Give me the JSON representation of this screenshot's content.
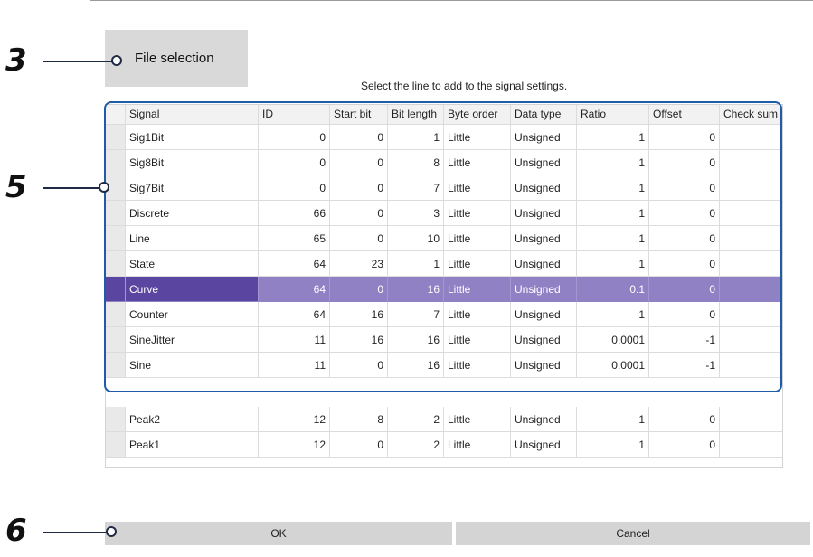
{
  "file_button": "File selection",
  "hint": "Select the line to add to the signal settings.",
  "columns": [
    "Signal",
    "ID",
    "Start bit",
    "Bit length",
    "Byte order",
    "Data type",
    "Ratio",
    "Offset",
    "Check sum"
  ],
  "rows": [
    {
      "signal": "Sig1Bit",
      "id": "0",
      "start": "0",
      "len": "1",
      "order": "Little",
      "dtype": "Unsigned",
      "ratio": "1",
      "offset": "0"
    },
    {
      "signal": "Sig8Bit",
      "id": "0",
      "start": "0",
      "len": "8",
      "order": "Little",
      "dtype": "Unsigned",
      "ratio": "1",
      "offset": "0"
    },
    {
      "signal": "Sig7Bit",
      "id": "0",
      "start": "0",
      "len": "7",
      "order": "Little",
      "dtype": "Unsigned",
      "ratio": "1",
      "offset": "0"
    },
    {
      "signal": "Discrete",
      "id": "66",
      "start": "0",
      "len": "3",
      "order": "Little",
      "dtype": "Unsigned",
      "ratio": "1",
      "offset": "0"
    },
    {
      "signal": "Line",
      "id": "65",
      "start": "0",
      "len": "10",
      "order": "Little",
      "dtype": "Unsigned",
      "ratio": "1",
      "offset": "0"
    },
    {
      "signal": "State",
      "id": "64",
      "start": "23",
      "len": "1",
      "order": "Little",
      "dtype": "Unsigned",
      "ratio": "1",
      "offset": "0"
    },
    {
      "signal": "Curve",
      "id": "64",
      "start": "0",
      "len": "16",
      "order": "Little",
      "dtype": "Unsigned",
      "ratio": "0.1",
      "offset": "0"
    },
    {
      "signal": "Counter",
      "id": "64",
      "start": "16",
      "len": "7",
      "order": "Little",
      "dtype": "Unsigned",
      "ratio": "1",
      "offset": "0"
    },
    {
      "signal": "SineJitter",
      "id": "11",
      "start": "16",
      "len": "16",
      "order": "Little",
      "dtype": "Unsigned",
      "ratio": "0.0001",
      "offset": "-1"
    },
    {
      "signal": "Sine",
      "id": "11",
      "start": "0",
      "len": "16",
      "order": "Little",
      "dtype": "Unsigned",
      "ratio": "0.0001",
      "offset": "-1"
    },
    {
      "signal": "Peak2",
      "id": "12",
      "start": "8",
      "len": "2",
      "order": "Little",
      "dtype": "Unsigned",
      "ratio": "1",
      "offset": "0"
    },
    {
      "signal": "Peak1",
      "id": "12",
      "start": "0",
      "len": "2",
      "order": "Little",
      "dtype": "Unsigned",
      "ratio": "1",
      "offset": "0"
    }
  ],
  "selected_row": "Curve",
  "ok_button": "OK",
  "cancel_button": "Cancel",
  "callouts": {
    "file": "3",
    "table": "5",
    "ok": "6"
  },
  "colors": {
    "selection": "#9081c4",
    "selection_signal": "#5a46a1",
    "highlight": "#1e5ca8"
  }
}
